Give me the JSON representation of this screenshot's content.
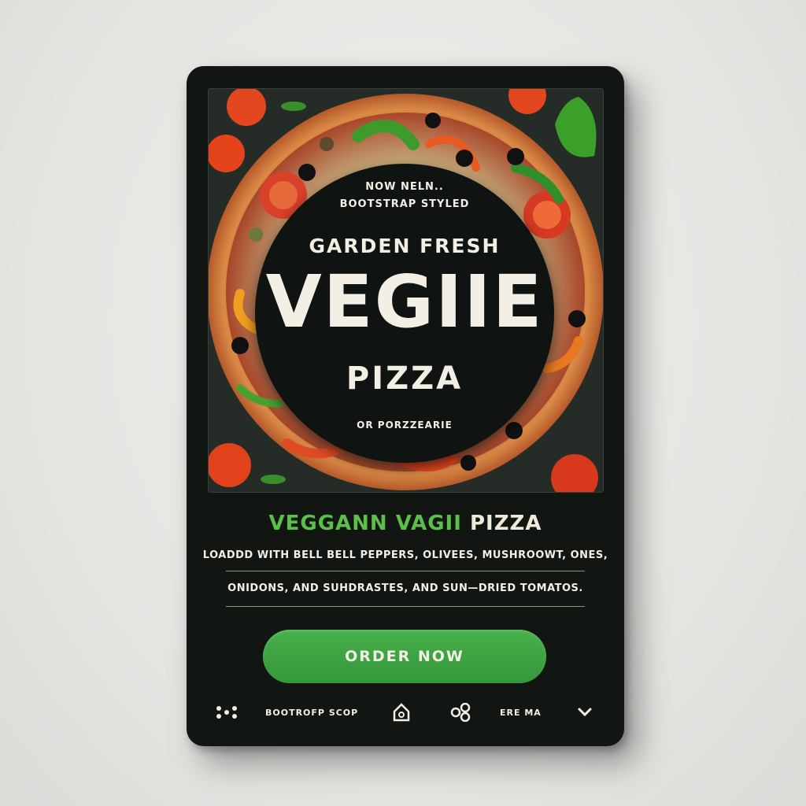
{
  "hero": {
    "badge_line1": "NOW NELN..",
    "badge_line2": "BOOTSTRAP STYLED",
    "badge_tagline": "GARDEN FRESH",
    "badge_title": "VEGIIE",
    "badge_subtitle": "PIZZA",
    "badge_footer": "OR PORZZEARIE"
  },
  "product": {
    "title_green": "VEGGANN VAGII",
    "title_white": "PIZZA",
    "desc_line1": "LOADDD WITH BELL BELL PEPPERS, OLIVEES, MUSHROOWT, ONES,",
    "desc_line2": "ONIDONS, AND SUHDRASTES, AND SUN—DRIED TOMATOS."
  },
  "actions": {
    "order_label": "ORDER NOW"
  },
  "footer": {
    "brand_label": "BOOTROFP SCOP",
    "menu_label": "ERE MA"
  },
  "colors": {
    "card": "#121613",
    "accent_green": "#5cbf4a",
    "button_green": "#3fa344",
    "cream": "#f3efe4"
  },
  "icons": [
    "apps-dots-icon",
    "home-icon",
    "share-icon",
    "chevron-down-icon"
  ]
}
